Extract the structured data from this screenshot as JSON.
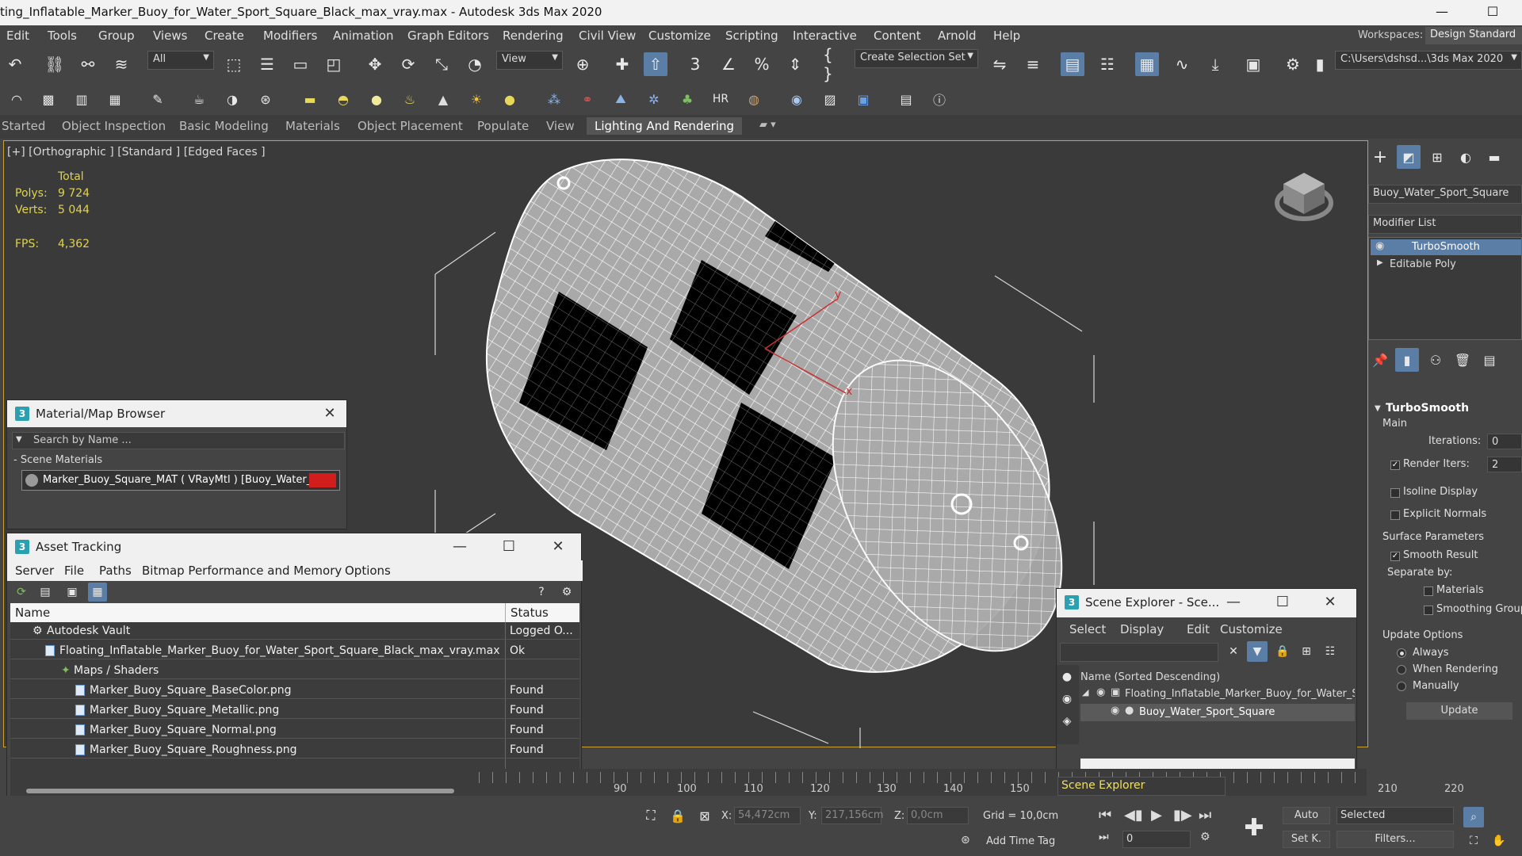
{
  "window": {
    "title": "ting_Inflatable_Marker_Buoy_for_Water_Sport_Square_Black_max_vray.max - Autodesk 3ds Max 2020",
    "minimize": "—",
    "maximize": "☐"
  },
  "menubar": {
    "items": [
      "Edit",
      "Tools",
      "Group",
      "Views",
      "Create",
      "Modifiers",
      "Animation",
      "Graph Editors",
      "Rendering",
      "Civil View",
      "Customize",
      "Scripting",
      "Interactive",
      "Content",
      "Arnold",
      "Help"
    ],
    "workspaces_label": "Workspaces:",
    "workspace_value": "Design Standard"
  },
  "toolbar": {
    "selection_filter": "All",
    "ref_coord": "View",
    "selection_set": "Create Selection Set",
    "project_path": "C:\\Users\\dshsd...\\3ds Max 2020"
  },
  "ribbon": {
    "tabs": [
      "Started",
      "Object Inspection",
      "Basic Modeling",
      "Materials",
      "Object Placement",
      "Populate",
      "View",
      "Lighting And Rendering"
    ],
    "selected_index": 7
  },
  "viewport": {
    "label": "[+] [Orthographic ] [Standard ] [Edged Faces ]",
    "stats": {
      "total_label": "Total",
      "polys_label": "Polys:",
      "polys_value": "9 724",
      "verts_label": "Verts:",
      "verts_value": "5 044",
      "fps_label": "FPS:",
      "fps_value": "4,362"
    },
    "gizmo": {
      "x_label": "x",
      "y_label": "y"
    }
  },
  "command_panel": {
    "object_name": "Buoy_Water_Sport_Square",
    "modifier_list": "Modifier List",
    "stack": [
      "TurboSmooth",
      "Editable Poly"
    ],
    "rollout_title": "TurboSmooth",
    "main_label": "Main",
    "iterations_label": "Iterations:",
    "iterations_value": "0",
    "render_iters_label": "Render Iters:",
    "render_iters_value": "2",
    "isoline_label": "Isoline Display",
    "explicit_normals_label": "Explicit Normals",
    "surface_params_label": "Surface Parameters",
    "smooth_result_label": "Smooth Result",
    "separate_by_label": "Separate by:",
    "materials_label": "Materials",
    "smoothing_groups_label": "Smoothing Groups",
    "update_options_label": "Update Options",
    "always_label": "Always",
    "when_rendering_label": "When Rendering",
    "manually_label": "Manually",
    "update_button": "Update"
  },
  "material_browser": {
    "title": "Material/Map Browser",
    "search_placeholder": "Search by Name ...",
    "section": "- Scene Materials",
    "material_entry": "Marker_Buoy_Square_MAT  ( VRayMtl )  [Buoy_Water_..."
  },
  "asset_tracking": {
    "title": "Asset Tracking",
    "menu": [
      "Server",
      "File",
      "Paths",
      "Bitmap Performance and Memory",
      "Options"
    ],
    "columns": [
      "Name",
      "Status"
    ],
    "rows": [
      {
        "name": "Autodesk Vault",
        "status": "Logged O..."
      },
      {
        "name": "Floating_Inflatable_Marker_Buoy_for_Water_Sport_Square_Black_max_vray.max",
        "status": "Ok"
      },
      {
        "name": "Maps / Shaders",
        "status": ""
      },
      {
        "name": "Marker_Buoy_Square_BaseColor.png",
        "status": "Found"
      },
      {
        "name": "Marker_Buoy_Square_Metallic.png",
        "status": "Found"
      },
      {
        "name": "Marker_Buoy_Square_Normal.png",
        "status": "Found"
      },
      {
        "name": "Marker_Buoy_Square_Roughness.png",
        "status": "Found"
      }
    ]
  },
  "scene_explorer": {
    "title": "Scene Explorer - Sce...",
    "menu": [
      "Select",
      "Display",
      "Edit",
      "Customize"
    ],
    "column": "Name (Sorted Descending)",
    "rows": [
      "Floating_Inflatable_Marker_Buoy_for_Water_Sp",
      "Buoy_Water_Sport_Square"
    ],
    "footer_dropdown": "Scene Explorer"
  },
  "timeline": {
    "ticks": [
      "90",
      "100",
      "110",
      "120",
      "130",
      "140",
      "150",
      "210",
      "220"
    ]
  },
  "status": {
    "x_label": "X:",
    "x_value": "54,472cm",
    "y_label": "Y:",
    "y_value": "217,156cm",
    "z_label": "Z:",
    "z_value": "0,0cm",
    "grid": "Grid = 10,0cm",
    "add_time_tag": "Add Time Tag",
    "auto": "Auto",
    "set_key": "Set K.",
    "selected": "Selected",
    "filters": "Filters...",
    "frame": "0"
  },
  "colors": {
    "accent": "#5b7ea6",
    "viewport_border": "#c9a233",
    "stats": "#e0d34d",
    "selected_stack": "#5b7ea6",
    "gizmo_red": "#c83030"
  }
}
